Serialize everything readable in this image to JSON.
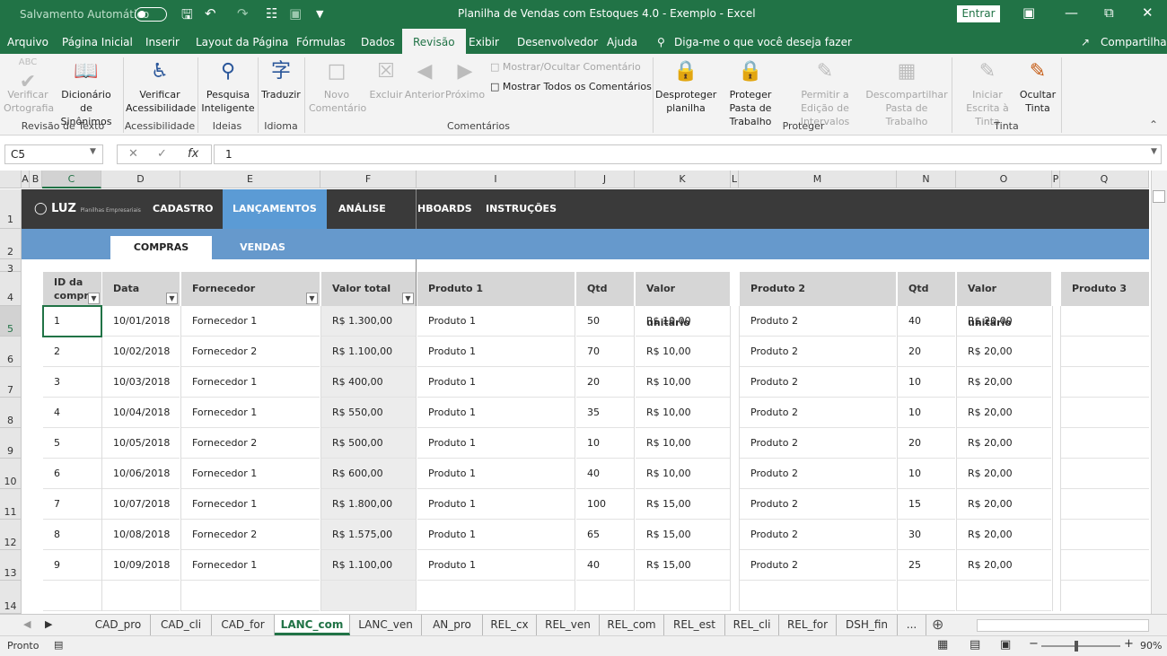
{
  "titlebar": {
    "autosave": "Salvamento Automático",
    "title": "Planilha de Vendas com Estoques 4.0 - Exemplo  -  Excel",
    "entrar": "Entrar"
  },
  "menu": {
    "tabs": [
      "Arquivo",
      "Página Inicial",
      "Inserir",
      "Layout da Página",
      "Fórmulas",
      "Dados",
      "Revisão",
      "Exibir",
      "Desenvolvedor",
      "Ajuda"
    ],
    "active": "Revisão",
    "tellme": "Diga-me o que você deseja fazer",
    "share": "Compartilhar"
  },
  "ribbon": {
    "verificar": "Verificar Ortografia",
    "dicionario": "Dicionário de Sinônimos",
    "acess": "Verificar Acessibilidade",
    "pesquisa": "Pesquisa Inteligente",
    "traduzir": "Traduzir",
    "novo": "Novo Comentário",
    "excluir": "Excluir",
    "anterior": "Anterior",
    "proximo": "Próximo",
    "mostrar_ocultar": "Mostrar/Ocultar Comentário",
    "mostrar_todos": "Mostrar Todos os Comentários",
    "desproteger": "Desproteger planilha",
    "proteger_pasta": "Proteger Pasta de Trabalho",
    "permitir": "Permitir a Edição de Intervalos",
    "descompartilhar": "Descompartilhar Pasta de Trabalho",
    "iniciar": "Iniciar Escrita à Tinta",
    "ocultar": "Ocultar Tinta",
    "groups": {
      "revisao": "Revisão de Texto",
      "acessibilidade": "Acessibilidade",
      "ideias": "Ideias",
      "idioma": "Idioma",
      "comentarios": "Comentários",
      "proteger": "Proteger",
      "tinta": "Tinta"
    },
    "abc": "ABC"
  },
  "formula": {
    "namebox": "C5",
    "value": "1",
    "fx": "fx"
  },
  "columns": [
    "A",
    "B",
    "C",
    "D",
    "E",
    "F",
    "I",
    "J",
    "K",
    "L",
    "M",
    "N",
    "O",
    "P",
    "Q"
  ],
  "rows": [
    "1",
    "2",
    "3",
    "4",
    "5",
    "6",
    "7",
    "8",
    "9",
    "10",
    "11",
    "12",
    "13",
    "14"
  ],
  "nav": {
    "logo": "LUZ",
    "logo_sub": "Planilhas Empresariais",
    "items": [
      "CADASTRO",
      "LANÇAMENTOS",
      "ANÁLISE",
      "HBOARDS",
      "INSTRUÇÕES"
    ],
    "sub": [
      "COMPRAS",
      "VENDAS"
    ]
  },
  "headers": [
    "ID da compra",
    "Data",
    "Fornecedor",
    "Valor total",
    "Produto 1",
    "Qtd",
    "Valor unitário",
    "Produto 2",
    "Qtd",
    "Valor unitário",
    "Produto 3"
  ],
  "data": [
    [
      "1",
      "10/01/2018",
      "Fornecedor 1",
      "R$ 1.300,00",
      "Produto 1",
      "50",
      "R$ 10,00",
      "Produto 2",
      "40",
      "R$ 20,00"
    ],
    [
      "2",
      "10/02/2018",
      "Fornecedor 2",
      "R$ 1.100,00",
      "Produto 1",
      "70",
      "R$ 10,00",
      "Produto 2",
      "20",
      "R$ 20,00"
    ],
    [
      "3",
      "10/03/2018",
      "Fornecedor 1",
      "R$ 400,00",
      "Produto 1",
      "20",
      "R$ 10,00",
      "Produto 2",
      "10",
      "R$ 20,00"
    ],
    [
      "4",
      "10/04/2018",
      "Fornecedor 1",
      "R$ 550,00",
      "Produto 1",
      "35",
      "R$ 10,00",
      "Produto 2",
      "10",
      "R$ 20,00"
    ],
    [
      "5",
      "10/05/2018",
      "Fornecedor 2",
      "R$ 500,00",
      "Produto 1",
      "10",
      "R$ 10,00",
      "Produto 2",
      "20",
      "R$ 20,00"
    ],
    [
      "6",
      "10/06/2018",
      "Fornecedor 1",
      "R$ 600,00",
      "Produto 1",
      "40",
      "R$ 10,00",
      "Produto 2",
      "10",
      "R$ 20,00"
    ],
    [
      "7",
      "10/07/2018",
      "Fornecedor 1",
      "R$ 1.800,00",
      "Produto 1",
      "100",
      "R$ 15,00",
      "Produto 2",
      "15",
      "R$ 20,00"
    ],
    [
      "8",
      "10/08/2018",
      "Fornecedor 2",
      "R$ 1.575,00",
      "Produto 1",
      "65",
      "R$ 15,00",
      "Produto 2",
      "30",
      "R$ 20,00"
    ],
    [
      "9",
      "10/09/2018",
      "Fornecedor 1",
      "R$ 1.100,00",
      "Produto 1",
      "40",
      "R$ 15,00",
      "Produto 2",
      "25",
      "R$ 20,00"
    ]
  ],
  "sheets": [
    "CAD_pro",
    "CAD_cli",
    "CAD_for",
    "LANC_com",
    "LANC_ven",
    "AN_pro",
    "REL_cx",
    "REL_ven",
    "REL_com",
    "REL_est",
    "REL_cli",
    "REL_for",
    "DSH_fin",
    "..."
  ],
  "active_sheet": "LANC_com",
  "status": {
    "ready": "Pronto",
    "zoom": "90%"
  }
}
